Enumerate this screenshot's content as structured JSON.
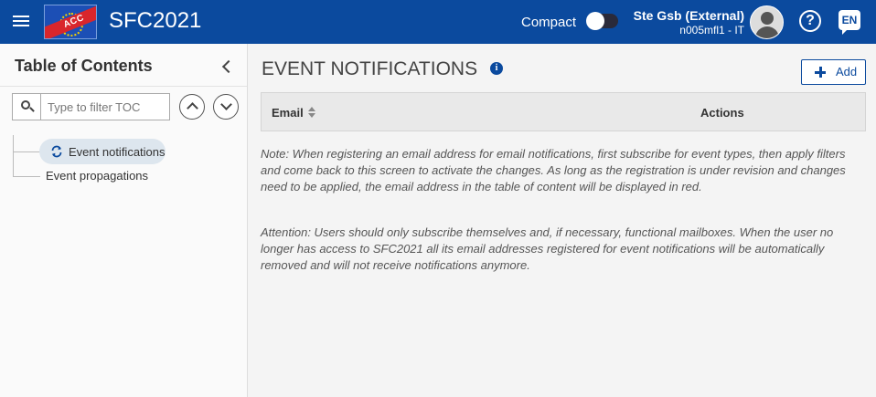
{
  "header": {
    "logo_text": "ACC",
    "app_title": "SFC2021",
    "compact_label": "Compact",
    "user_name": "Ste Gsb (External)",
    "user_sub": "n005mfl1 - IT",
    "help_symbol": "?",
    "language": "EN",
    "brand_color": "#0b4a9e"
  },
  "sidebar": {
    "title": "Table of Contents",
    "search_placeholder": "Type to filter TOC",
    "items": [
      {
        "label": "Event notifications",
        "active": true,
        "icon": "sync-icon"
      },
      {
        "label": "Event propagations",
        "active": false
      }
    ]
  },
  "main": {
    "title": "EVENT NOTIFICATIONS",
    "info_symbol": "i",
    "add_label": "Add",
    "table": {
      "columns": [
        "Email",
        "Actions"
      ]
    },
    "note": "Note: When registering an email address for email notifications, first subscribe for event types, then apply filters and come back to this screen to activate the changes. As long as the registration is under revision and changes need to be applied, the email address in the table of content will be displayed in red.",
    "attention": "Attention: Users should only subscribe themselves and, if necessary, functional mailboxes. When the user no longer has access to SFC2021 all its email addresses registered for event notifications will be automatically removed and will not receive notifications anymore."
  }
}
